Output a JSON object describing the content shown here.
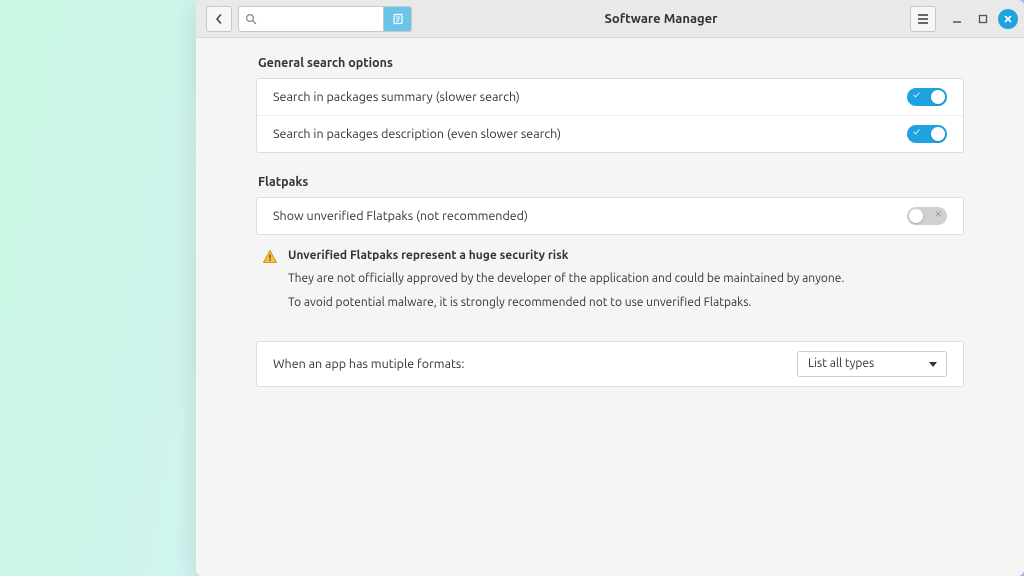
{
  "window": {
    "title": "Software Manager"
  },
  "search": {
    "placeholder": ""
  },
  "sections": {
    "general": {
      "title": "General search options",
      "opt1": "Search in packages summary (slower search)",
      "opt2": "Search in packages description (even slower search)"
    },
    "flatpaks": {
      "title": "Flatpaks",
      "opt1": "Show unverified Flatpaks (not recommended)",
      "warn_title": "Unverified Flatpaks represent a huge security risk",
      "warn_p1": "They are not officially approved by the developer of the application and could be maintained by anyone.",
      "warn_p2": "To avoid potential malware, it is strongly recommended not to use unverified Flatpaks."
    },
    "formats": {
      "label": "When an app has mutiple formats:",
      "selected": "List all types"
    }
  }
}
